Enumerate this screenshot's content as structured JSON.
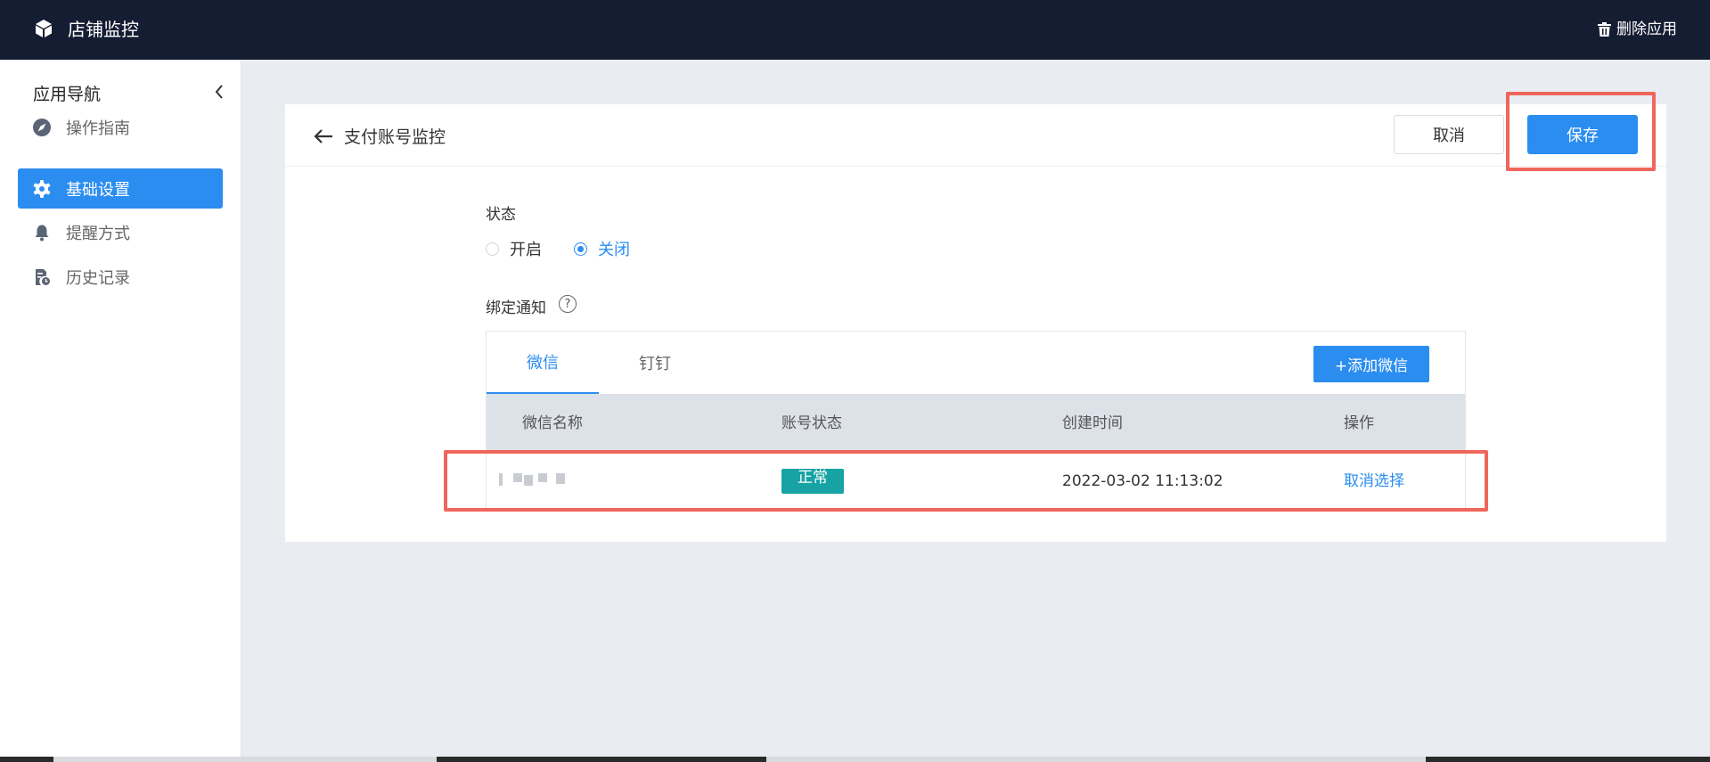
{
  "app": {
    "title": "店铺监控",
    "delete_label": "删除应用",
    "icons": {
      "logo": "cube-icon",
      "delete": "trash-icon"
    }
  },
  "sidebar": {
    "title": "应用导航",
    "items": [
      {
        "label": "操作指南",
        "icon": "compass-icon",
        "active": false
      },
      {
        "label": "基础设置",
        "icon": "gear-icon",
        "active": true
      },
      {
        "label": "提醒方式",
        "icon": "bell-icon",
        "active": false
      },
      {
        "label": "历史记录",
        "icon": "history-document-icon",
        "active": false
      }
    ]
  },
  "page": {
    "title": "支付账号监控",
    "cancel_label": "取消",
    "save_label": "保存"
  },
  "status": {
    "label": "状态",
    "options": [
      {
        "label": "开启",
        "checked": false
      },
      {
        "label": "关闭",
        "checked": true
      }
    ]
  },
  "notify": {
    "label": "绑定通知",
    "help_icon": "?",
    "tabs": [
      {
        "label": "微信",
        "active": true
      },
      {
        "label": "钉钉",
        "active": false
      }
    ],
    "add_label": "+添加微信",
    "columns": [
      "微信名称",
      "账号状态",
      "创建时间",
      "操作"
    ],
    "rows": [
      {
        "name": "",
        "status": "正常",
        "created": "2022-03-02 11:13:02",
        "action": "取消选择"
      }
    ]
  },
  "colors": {
    "topbar": "#151d33",
    "accent": "#2b8def",
    "badge": "#17a3a3",
    "highlight": "#f0665c",
    "background": "#e9edf2"
  }
}
